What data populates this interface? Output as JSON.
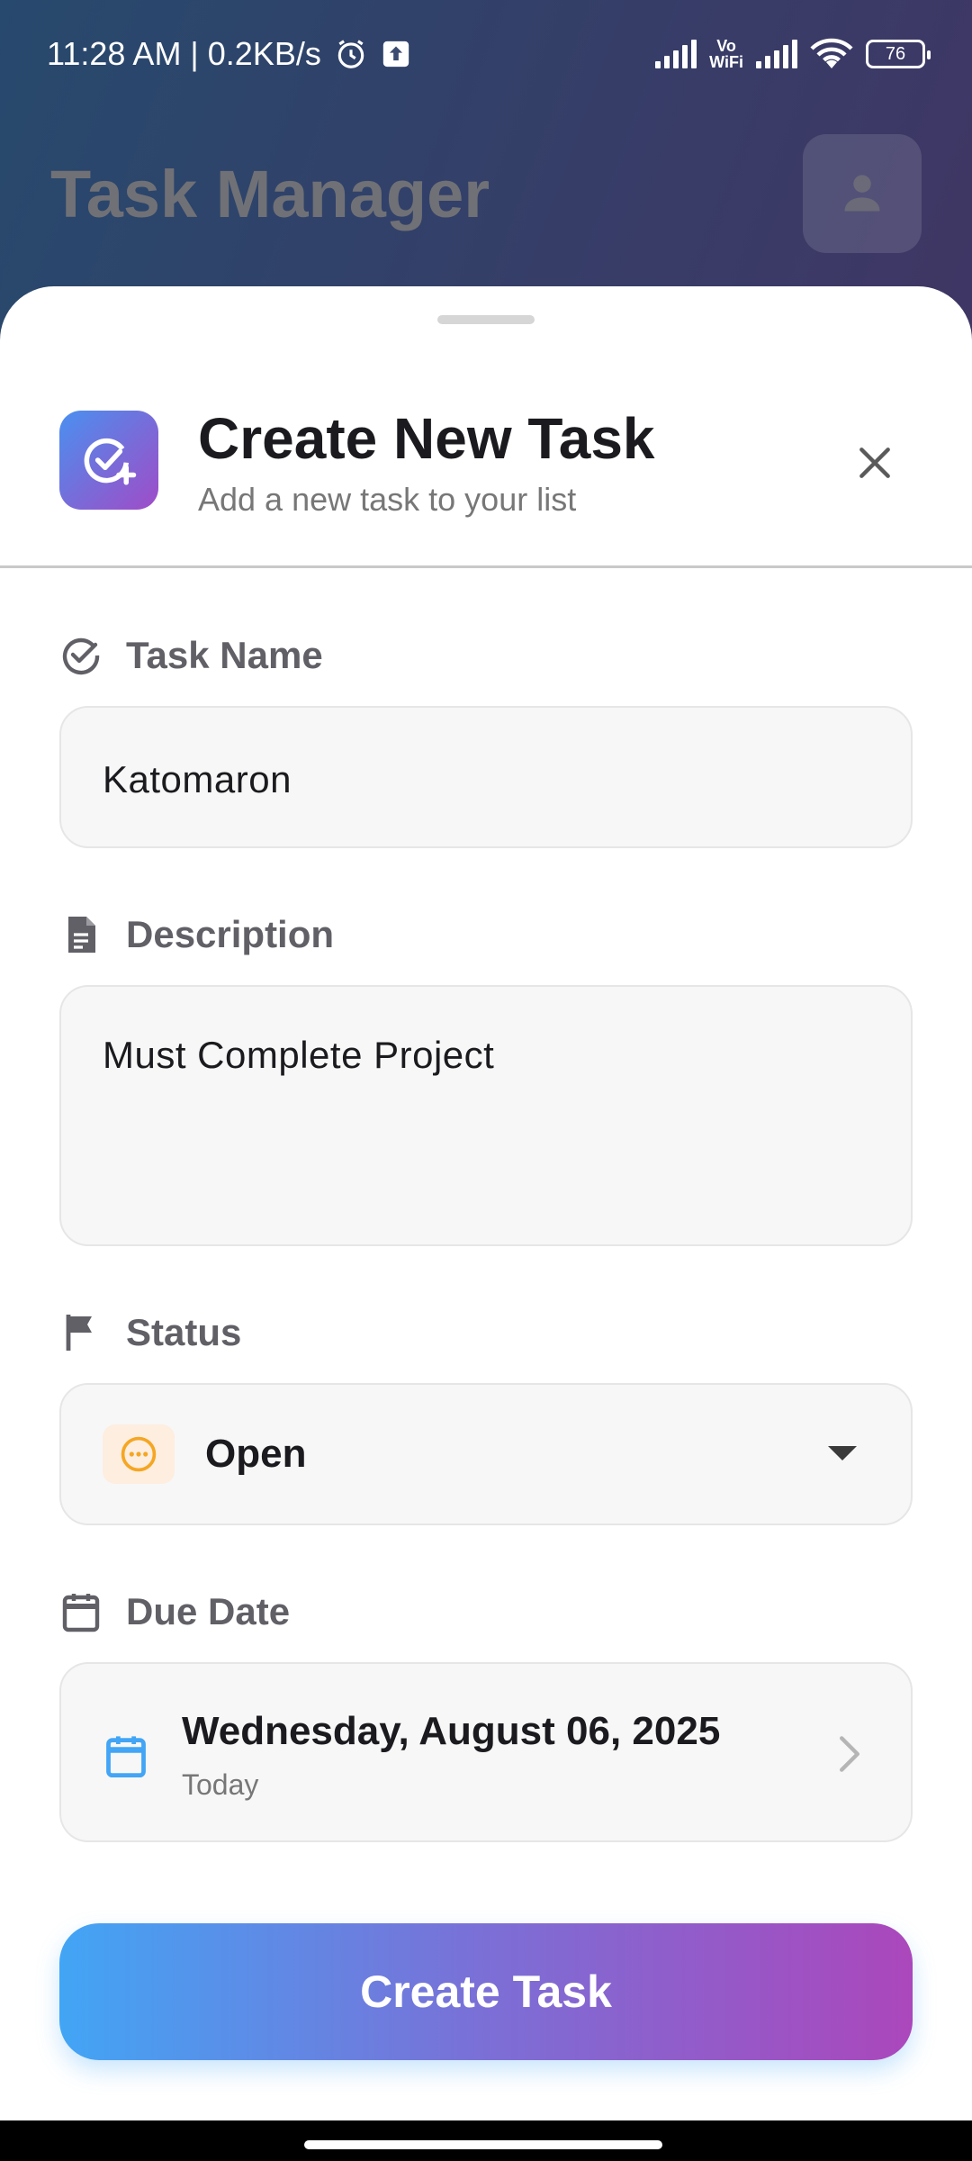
{
  "status_bar": {
    "time_speed": "11:28 AM | 0.2KB/s",
    "vowifi_top": "Vo",
    "vowifi_bottom": "WiFi",
    "battery": "76"
  },
  "app": {
    "title": "Task Manager"
  },
  "sheet": {
    "title": "Create New Task",
    "subtitle": "Add a new task to your list",
    "task_name": {
      "label": "Task Name",
      "value": "Katomaron"
    },
    "description": {
      "label": "Description",
      "value": "Must Complete Project"
    },
    "status": {
      "label": "Status",
      "value": "Open"
    },
    "due_date": {
      "label": "Due Date",
      "value": "Wednesday, August 06, 2025",
      "relative": "Today"
    },
    "submit_label": "Create Task"
  },
  "colors": {
    "accent_blue": "#42a5f5",
    "accent_purple": "#ab47bc",
    "status_open": "#f5a623",
    "date_icon": "#42a5f5"
  },
  "icons": {
    "header": "task-add-icon",
    "close": "close-icon",
    "task_name": "check-circle-icon",
    "description": "document-icon",
    "status": "flag-icon",
    "due_date": "calendar-icon",
    "status_chip": "pending-icon",
    "date_chevron": "chevron-right-icon",
    "profile": "person-icon"
  }
}
